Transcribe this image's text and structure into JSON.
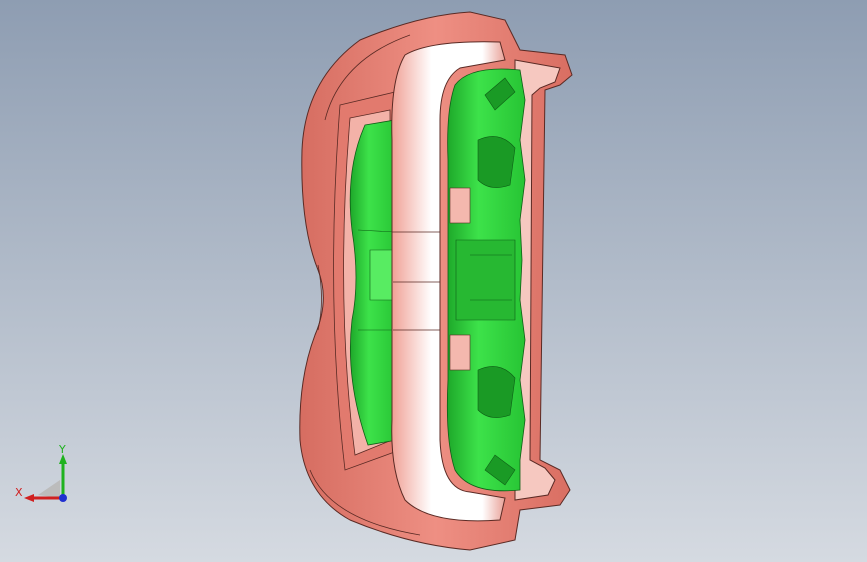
{
  "viewport": {
    "background_top": "#8f9fb3",
    "background_bottom": "#d4d9e0"
  },
  "model": {
    "shell_color": "#e98478",
    "shell_shade": "#c75e53",
    "inner_color": "#f7c9c2",
    "insert_color": "#2fe13c",
    "insert_shade": "#19a827"
  },
  "triad": {
    "x_label": "X",
    "y_label": "Y",
    "x_color": "#d02020",
    "y_color": "#1fb21f",
    "z_color": "#2030d0"
  }
}
